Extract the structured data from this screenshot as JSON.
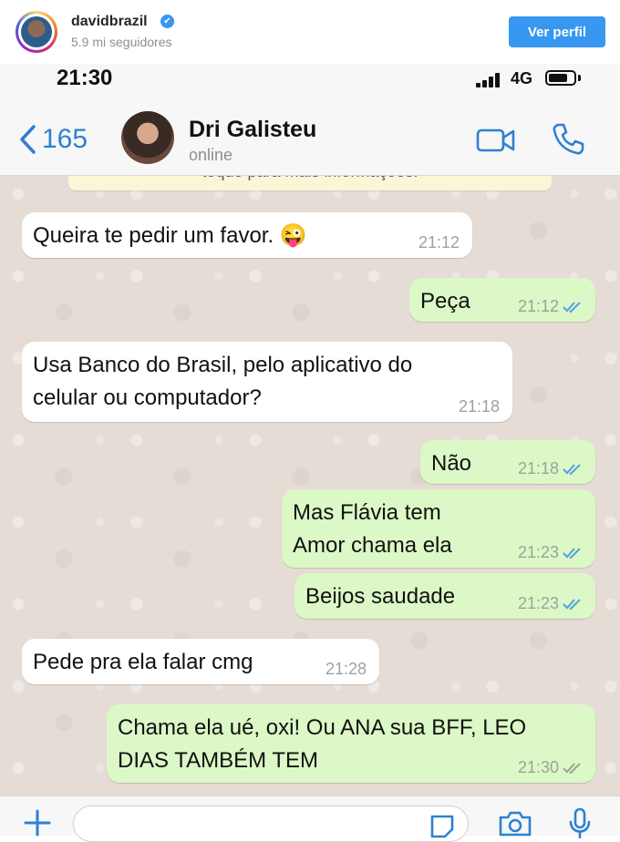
{
  "instagram": {
    "username": "davidbrazil",
    "verified_mark": "✔",
    "followers": "5.9 mi seguidores",
    "button_label": "Ver perfil",
    "accent": "#3897f0"
  },
  "status_bar": {
    "time": "21:30",
    "network": "4G"
  },
  "chat_header": {
    "back_count": "165",
    "contact_name": "Dri Galisteu",
    "contact_status": "online"
  },
  "system_note": "toque para mais informações.",
  "messages": [
    {
      "direction": "in",
      "text": "Queira te pedir um favor. 😜",
      "time": "21:12"
    },
    {
      "direction": "out",
      "text": "Peça",
      "time": "21:12",
      "status": "read"
    },
    {
      "direction": "in",
      "text": "Usa Banco do Brasil, pelo aplicativo do\ncelular ou computador?",
      "time": "21:18"
    },
    {
      "direction": "out",
      "text": "Não",
      "time": "21:18",
      "status": "read"
    },
    {
      "direction": "out",
      "text": "Mas Flávia tem\nAmor chama ela",
      "time": "21:23",
      "status": "read"
    },
    {
      "direction": "out",
      "text": "Beijos saudade",
      "time": "21:23",
      "status": "read"
    },
    {
      "direction": "in",
      "text": "Pede pra ela falar cmg",
      "time": "21:28"
    },
    {
      "direction": "out",
      "text": "Chama ela ué, oxi! Ou ANA sua BFF, LEO\nDIAS TAMBÉM TEM",
      "time": "21:30",
      "status": "delivered"
    }
  ],
  "colors": {
    "outgoing_bubble": "#dcf8c6",
    "incoming_bubble": "#ffffff",
    "chat_background": "#e5ddd5",
    "ios_blue": "#2f80d1",
    "read_ticks": "#4fa3e0",
    "delivered_ticks": "#9aa39a"
  },
  "icons": {
    "back": "chevron-left-icon",
    "video": "video-camera-icon",
    "phone": "phone-icon",
    "plus": "plus-icon",
    "sticker": "sticker-icon",
    "camera": "camera-icon",
    "mic": "microphone-icon"
  }
}
